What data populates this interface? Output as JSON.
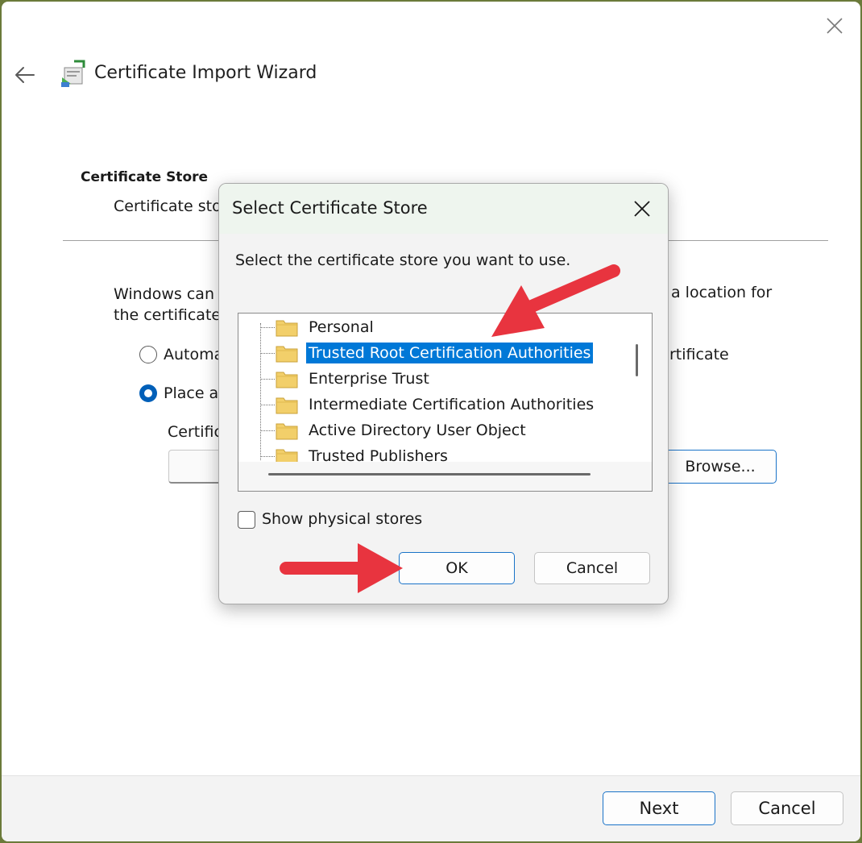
{
  "wizard": {
    "title": "Certificate Import Wizard",
    "section_title": "Certificate Store",
    "section_desc": "Certificate sto",
    "body_text_left": "Windows can",
    "body_text_right": "a location for",
    "body_text_line2": "the certificate",
    "radio_auto_label": "Automa",
    "radio_auto_right": "rtificate",
    "radio_place_label": "Place a",
    "store_label": "Certific",
    "browse_label": "Browse...",
    "selected_radio": "place"
  },
  "dialog": {
    "title": "Select Certificate Store",
    "prompt": "Select the certificate store you want to use.",
    "stores": [
      {
        "label": "Personal",
        "selected": false
      },
      {
        "label": "Trusted Root Certification Authorities",
        "selected": true
      },
      {
        "label": "Enterprise Trust",
        "selected": false
      },
      {
        "label": "Intermediate Certification Authorities",
        "selected": false
      },
      {
        "label": "Active Directory User Object",
        "selected": false
      },
      {
        "label": "Trusted Publishers",
        "selected": false
      }
    ],
    "show_physical_label": "Show physical stores",
    "show_physical_checked": false,
    "ok_label": "OK",
    "cancel_label": "Cancel"
  },
  "footer": {
    "next_label": "Next",
    "cancel_label": "Cancel"
  },
  "colors": {
    "accent": "#005fb8",
    "selection": "#0078d7",
    "annotation_arrow": "#e8343f",
    "folder": "#f2cf6a"
  }
}
